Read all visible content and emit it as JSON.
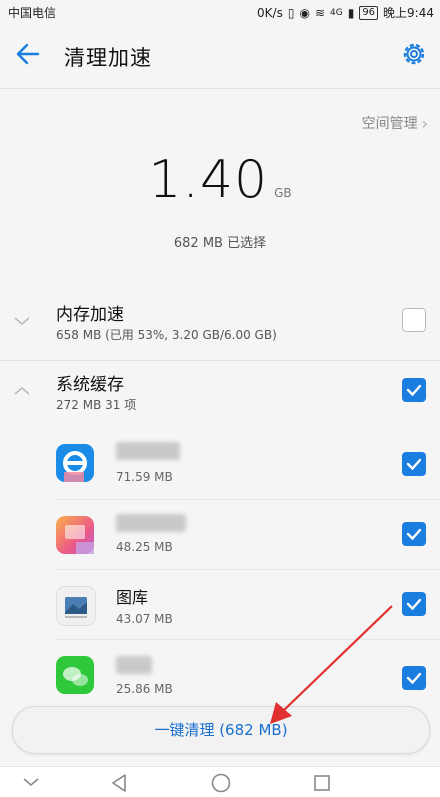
{
  "status_bar": {
    "carrier": "中国电信",
    "speed": "0K/s",
    "network": "4G",
    "battery": "96",
    "time": "晚上9:44"
  },
  "header": {
    "title": "清理加速"
  },
  "summary": {
    "space_management": "空间管理",
    "amount": "1.40",
    "unit": "GB",
    "selected": "682 MB 已选择"
  },
  "sections": [
    {
      "title": "内存加速",
      "subtitle": "658 MB (已用 53%, 3.20 GB/6.00 GB)",
      "checked": false,
      "expanded": false
    },
    {
      "title": "系统缓存",
      "subtitle": "272 MB  31 项",
      "checked": true,
      "expanded": true
    }
  ],
  "apps": [
    {
      "name": "",
      "size": "71.59 MB",
      "checked": true,
      "icon": "blue-e-app-icon"
    },
    {
      "name": "",
      "size": "48.25 MB",
      "checked": true,
      "icon": "orange-pink-app-icon"
    },
    {
      "name": "图库",
      "size": "43.07 MB",
      "checked": true,
      "icon": "gallery-icon"
    },
    {
      "name": "",
      "size": "25.86 MB",
      "checked": true,
      "icon": "green-chat-app-icon"
    }
  ],
  "clean_button": {
    "label": "一键清理 (682 MB)"
  },
  "colors": {
    "accent": "#1a7de0",
    "annotation": "#e03030"
  }
}
